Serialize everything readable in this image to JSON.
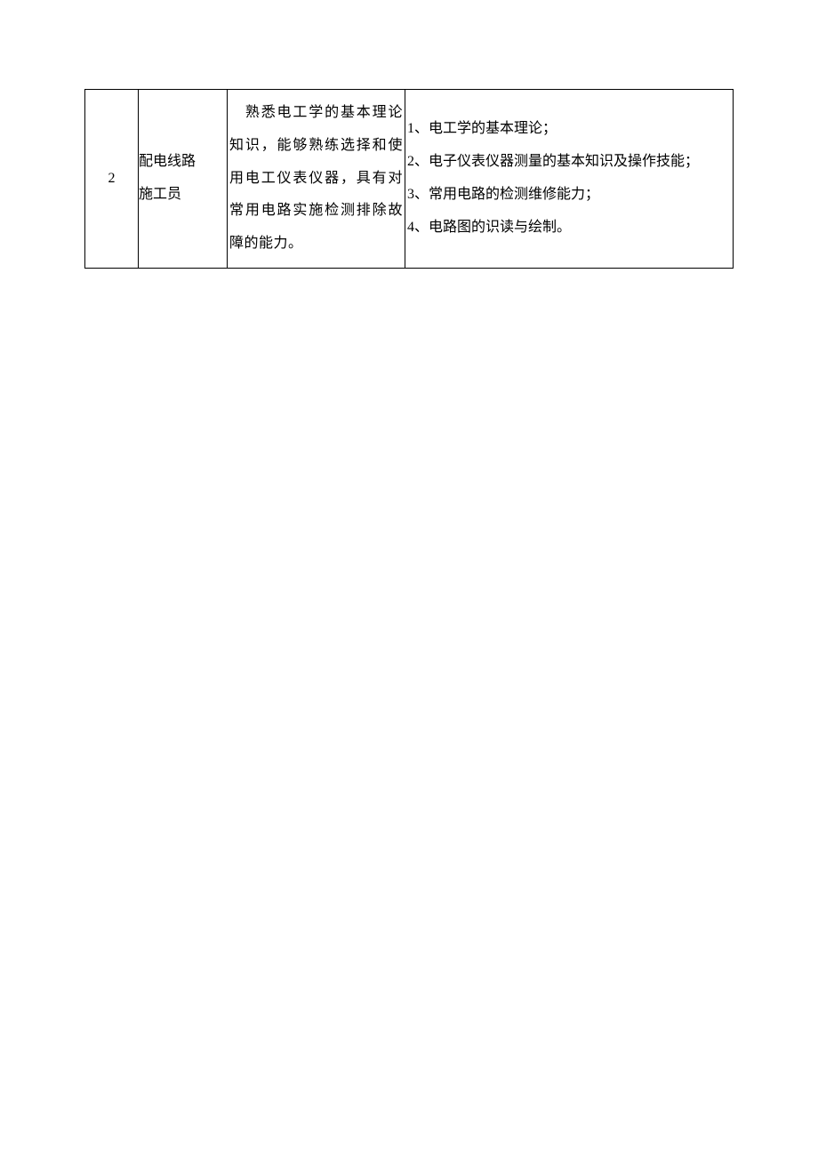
{
  "table": {
    "row": {
      "index": "2",
      "role_line1": "配电线路",
      "role_line2": "施工员",
      "description": "　熟悉电工学的基本理论知识，能够熟练选择和使用电工仪表仪器，具有对常用电路实施检测排除故障的能力。",
      "points": [
        "1、电工学的基本理论；",
        "2、电子仪表仪器测量的基本知识及操作技能；",
        "3、常用电路的检测维修能力；",
        "4、电路图的识读与绘制。"
      ]
    }
  }
}
